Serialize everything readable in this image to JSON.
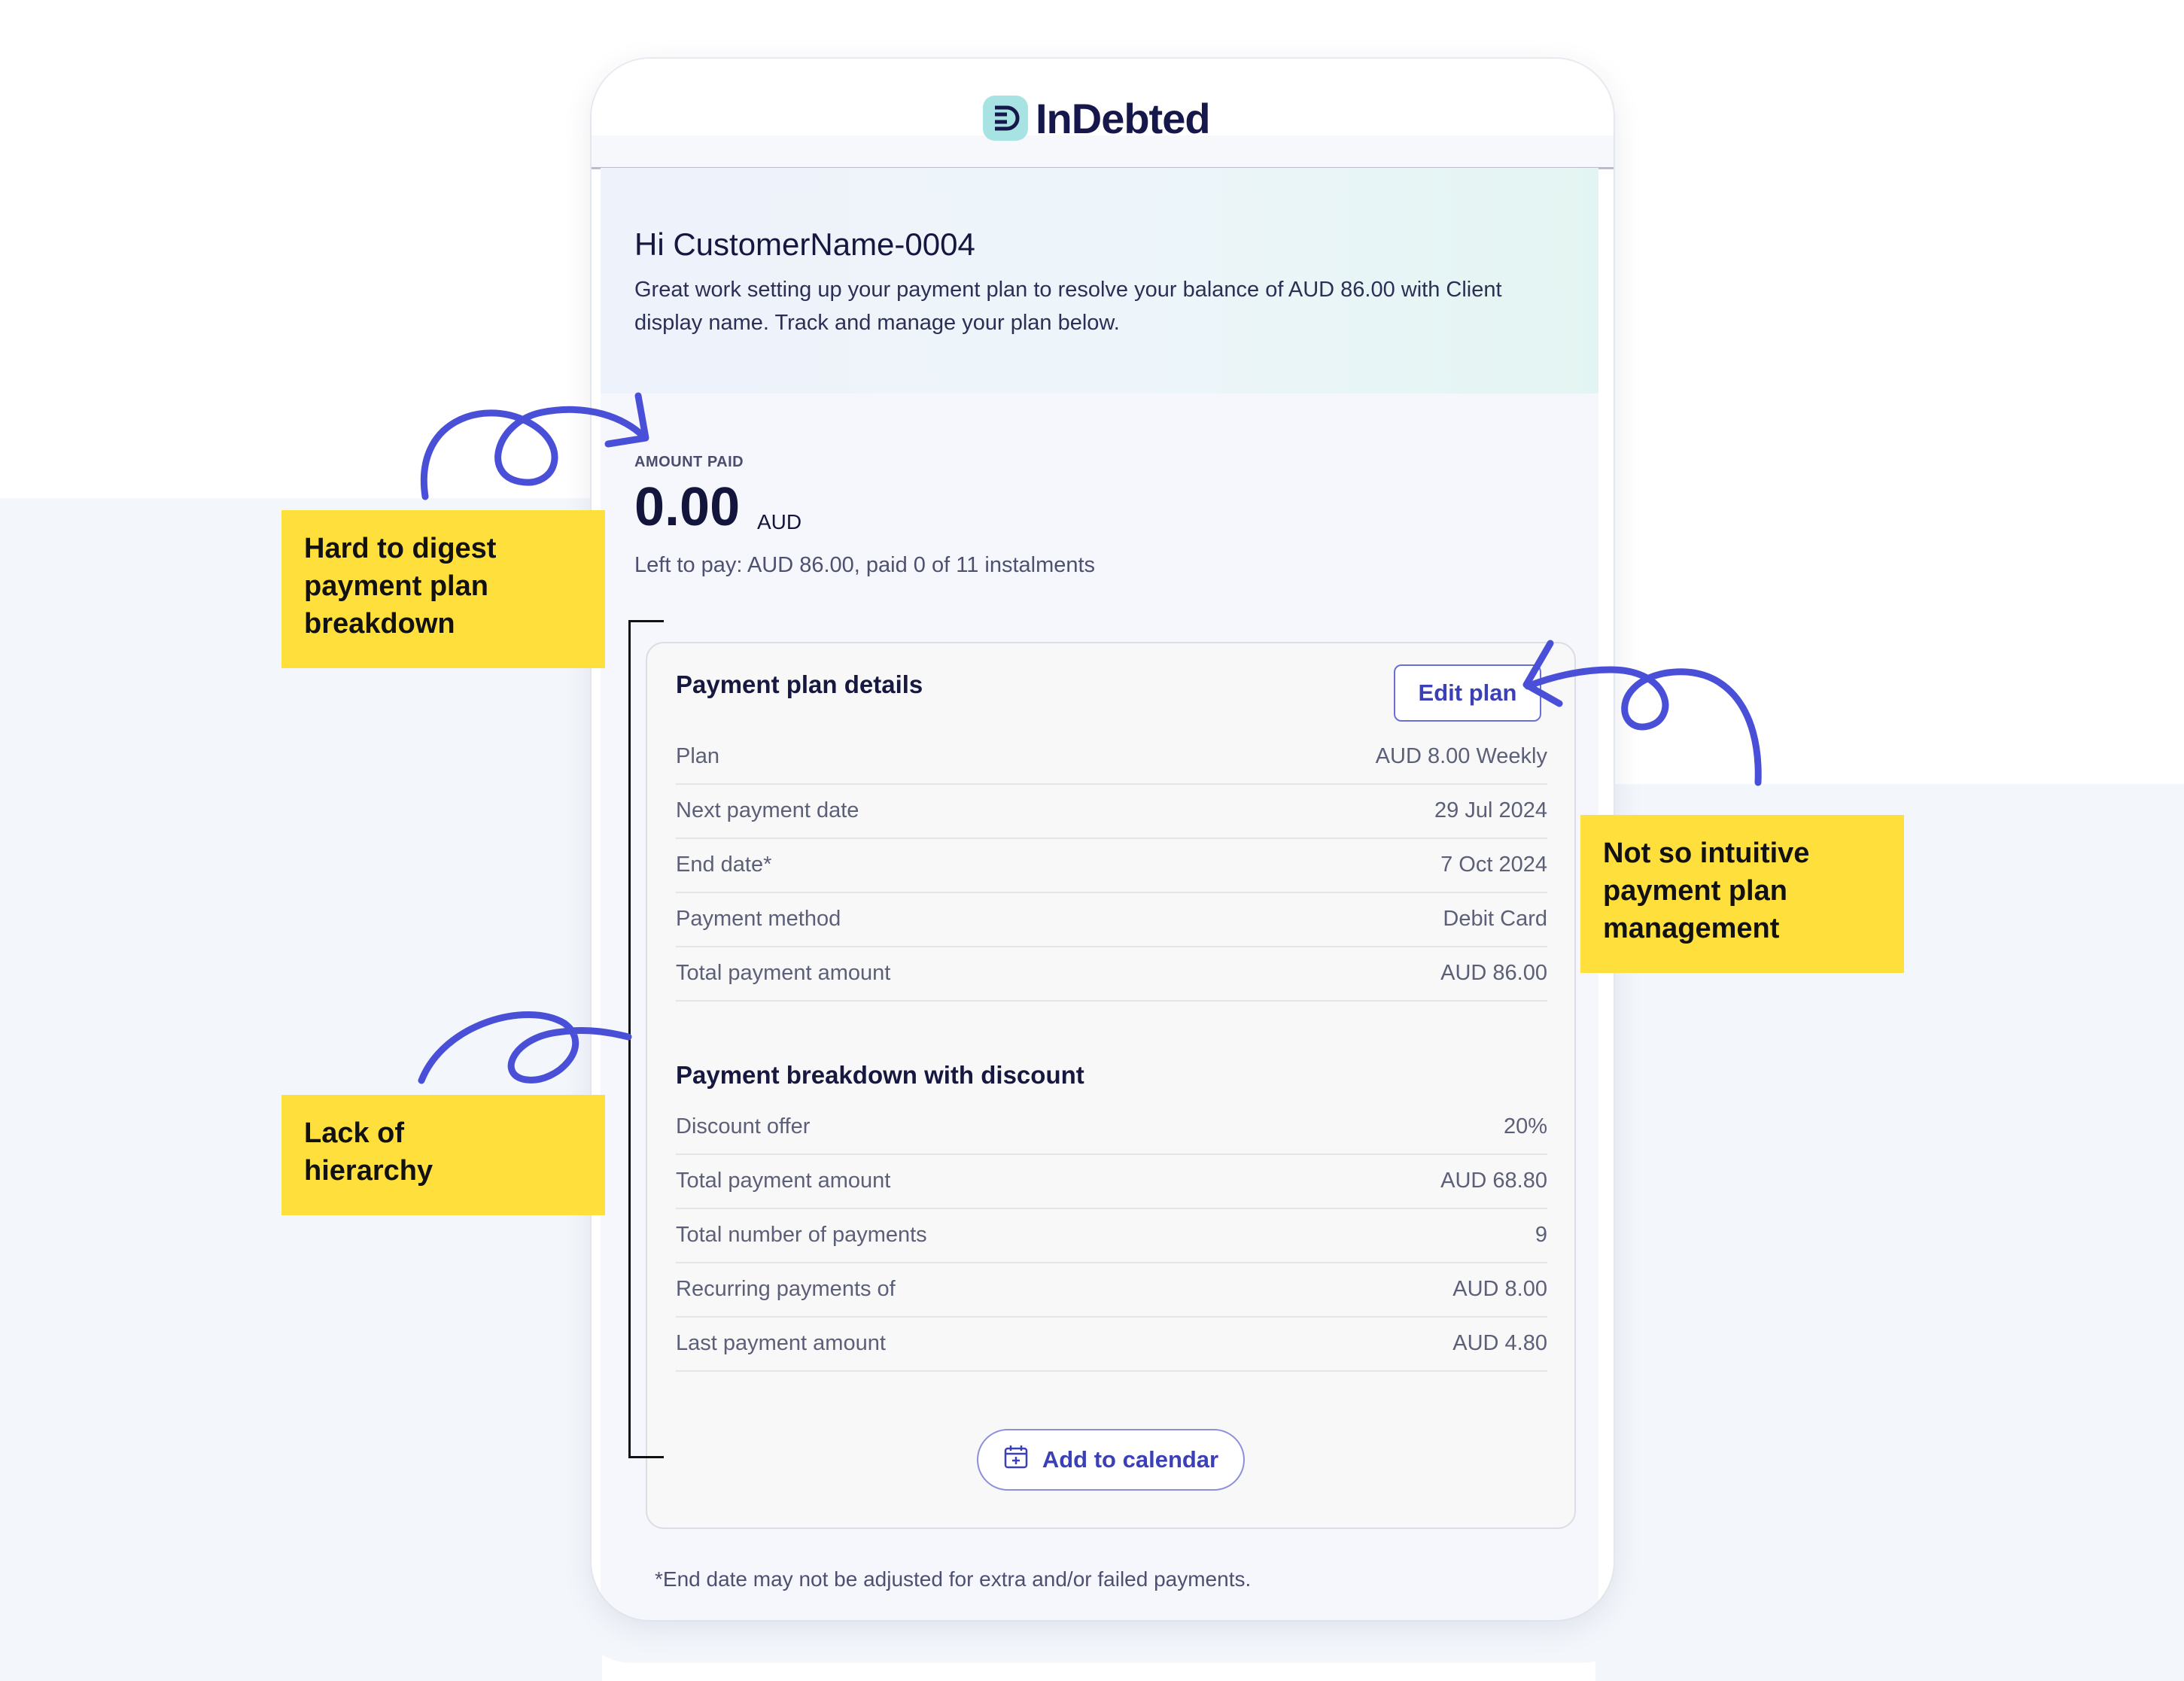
{
  "app": {
    "logo_text": "InDebted",
    "logo_icon": "indebted-logo-icon"
  },
  "hero": {
    "greeting": "Hi CustomerName-0004",
    "intro": "Great work setting up your payment plan to resolve your balance of AUD 86.00 with Client display name. Track and manage your plan below."
  },
  "amount": {
    "label": "AMOUNT PAID",
    "value": "0.00",
    "currency": "AUD",
    "left_to_pay": "Left to pay: AUD 86.00, paid 0 of 11 instalments"
  },
  "plan_details": {
    "title": "Payment plan details",
    "edit_label": "Edit plan",
    "rows": [
      {
        "label": "Plan",
        "value": "AUD 8.00 Weekly"
      },
      {
        "label": "Next payment date",
        "value": "29 Jul 2024"
      },
      {
        "label": "End date*",
        "value": "7 Oct 2024"
      },
      {
        "label": "Payment method",
        "value": "Debit Card"
      },
      {
        "label": "Total payment amount",
        "value": "AUD 86.00"
      }
    ]
  },
  "breakdown": {
    "title": "Payment breakdown with discount",
    "rows": [
      {
        "label": "Discount offer",
        "value": "20%"
      },
      {
        "label": "Total payment amount",
        "value": "AUD 68.80"
      },
      {
        "label": "Total number of payments",
        "value": "9"
      },
      {
        "label": "Recurring payments of",
        "value": "AUD 8.00"
      },
      {
        "label": "Last payment amount",
        "value": "AUD 4.80"
      }
    ],
    "calendar_label": "Add to calendar",
    "calendar_icon": "calendar-plus-icon"
  },
  "footnote": "*End date may not be adjusted for extra and/or failed payments.",
  "annotations": {
    "note1": [
      "Hard to digest",
      "payment plan",
      "breakdown"
    ],
    "note2": [
      "Not so  intuitive",
      "payment plan",
      "management"
    ],
    "note3": [
      "Lack of",
      "hierarchy"
    ]
  },
  "colors": {
    "note_yellow": "#ffdf3c",
    "arrow_blue": "#4a4fd8",
    "accent": "#3c40b8"
  }
}
